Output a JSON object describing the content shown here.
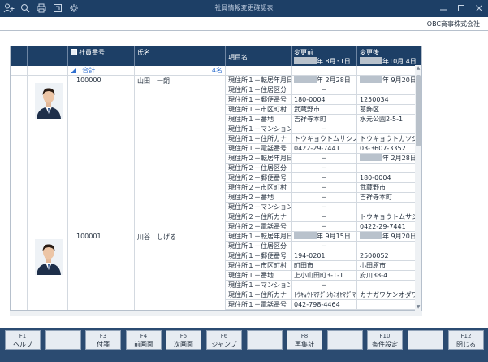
{
  "window": {
    "title": "社員情報変更確認表",
    "company": "OBC商事株式会社"
  },
  "header": {
    "employee_no": "社員番号",
    "name": "氏名",
    "item": "項目名",
    "before_label": "変更前",
    "before_date": "年 8月31日",
    "after_label": "変更後",
    "after_date": "年10月 4日"
  },
  "summary": {
    "label": "合計",
    "count": "4名"
  },
  "employees": [
    {
      "no": "100000",
      "name": "山田　一朗",
      "rows": [
        {
          "item": "現住所１－転居年月日",
          "before": "年 2月28日",
          "after": "年 9月20日",
          "type": "date"
        },
        {
          "item": "現住所１－住居区分",
          "before": "－",
          "after": ""
        },
        {
          "item": "現住所１－郵便番号",
          "before": "180-0004",
          "after": "1250034"
        },
        {
          "item": "現住所１－市区町村",
          "before": "武蔵野市",
          "after": "葛飾区"
        },
        {
          "item": "現住所１－番地",
          "before": "吉祥寺本町",
          "after": "水元公園2-5-1"
        },
        {
          "item": "現住所１－マンション",
          "before": "－",
          "after": ""
        },
        {
          "item": "現住所１－住所カナ",
          "before": "トウキョウトムサシノ",
          "after": "トウキョウトカツシカ"
        },
        {
          "item": "現住所１－電話番号",
          "before": "0422-29-7441",
          "after": "03-3607-3352"
        },
        {
          "item": "現住所２－転居年月日",
          "before": "－",
          "after": "年 2月28日",
          "type": "date-after"
        },
        {
          "item": "現住所２－住居区分",
          "before": "－",
          "after": ""
        },
        {
          "item": "現住所２－郵便番号",
          "before": "－",
          "after": "180-0004"
        },
        {
          "item": "現住所２－市区町村",
          "before": "－",
          "after": "武蔵野市"
        },
        {
          "item": "現住所２－番地",
          "before": "－",
          "after": "吉祥寺本町"
        },
        {
          "item": "現住所２－マンション",
          "before": "－",
          "after": ""
        },
        {
          "item": "現住所２－住所カナ",
          "before": "－",
          "after": "トウキョウトムサシノ"
        },
        {
          "item": "現住所２－電話番号",
          "before": "－",
          "after": "0422-29-7441"
        }
      ]
    },
    {
      "no": "100001",
      "name": "川谷　しげる",
      "rows": [
        {
          "item": "現住所１－転居年月日",
          "before": "年 9月15日",
          "after": "年 9月20日",
          "type": "date"
        },
        {
          "item": "現住所１－住居区分",
          "before": "－",
          "after": ""
        },
        {
          "item": "現住所１－郵便番号",
          "before": "194-0201",
          "after": "2500052"
        },
        {
          "item": "現住所１－市区町村",
          "before": "町田市",
          "after": "小田原市"
        },
        {
          "item": "現住所１－番地",
          "before": "上小山田町3-1-1",
          "after": "府川38-4"
        },
        {
          "item": "現住所１－マンション",
          "before": "－",
          "after": ""
        },
        {
          "item": "現住所１－住所カナ",
          "before": "ﾄｳｷｮｳﾄﾏﾁﾀﾞｼｶﾐｵﾔﾏﾀﾞﾏﾁ",
          "after": "カナガワケンオダワラ"
        },
        {
          "item": "現住所１－電話番号",
          "before": "042-798-4464",
          "after": ""
        }
      ]
    }
  ],
  "fkeys": [
    {
      "num": "F1",
      "label": "ヘルプ"
    },
    {
      "num": "",
      "label": ""
    },
    {
      "num": "F3",
      "label": "付箋"
    },
    {
      "num": "F4",
      "label": "前画面"
    },
    {
      "num": "F5",
      "label": "次画面"
    },
    {
      "num": "F6",
      "label": "ジャンプ"
    },
    {
      "num": "",
      "label": ""
    },
    {
      "num": "F8",
      "label": "再集計"
    },
    {
      "num": "",
      "label": ""
    },
    {
      "num": "F10",
      "label": "条件設定"
    },
    {
      "num": "",
      "label": ""
    },
    {
      "num": "F12",
      "label": "閉じる"
    }
  ]
}
